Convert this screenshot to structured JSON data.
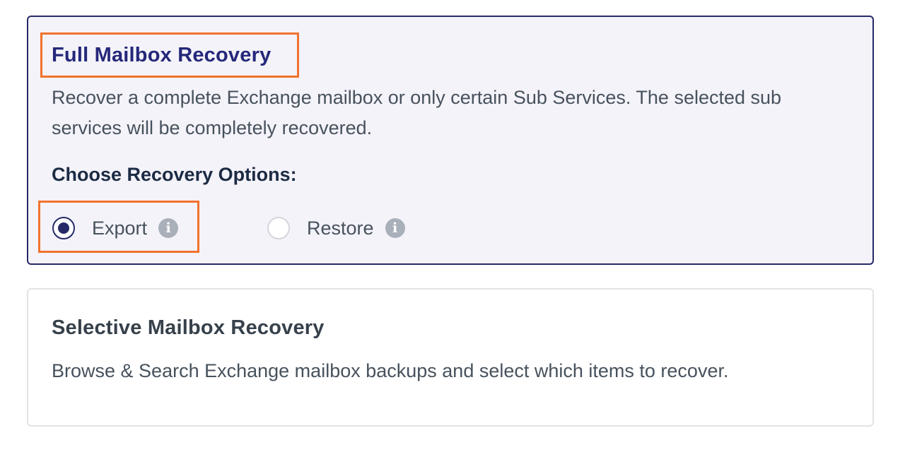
{
  "full_recovery": {
    "title": "Full Mailbox Recovery",
    "description": "Recover a complete Exchange mailbox or only certain Sub Services. The selected sub services will be completely recovered.",
    "options_label": "Choose Recovery Options:",
    "options": [
      {
        "label": "Export",
        "selected": true,
        "icon": "info-icon"
      },
      {
        "label": "Restore",
        "selected": false,
        "icon": "info-icon"
      }
    ]
  },
  "selective_recovery": {
    "title": "Selective Mailbox Recovery",
    "description": "Browse & Search Exchange mailbox backups and select which items to recover."
  },
  "colors": {
    "accent": "#262a68",
    "title": "#25287a",
    "highlight": "#f1722d",
    "selected_card_bg": "#f4f3f9",
    "info_icon": "#a9b0ba"
  }
}
